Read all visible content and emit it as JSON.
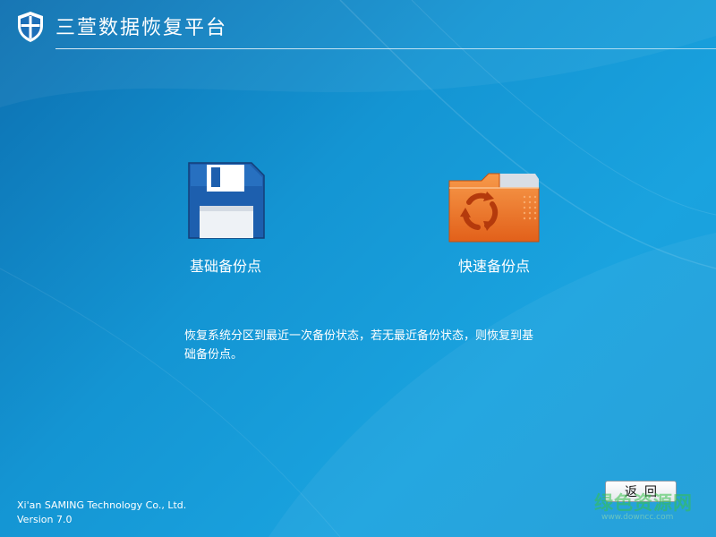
{
  "header": {
    "title": "三萱数据恢复平台"
  },
  "options": [
    {
      "label": "基础备份点",
      "icon": "floppy-disk-icon"
    },
    {
      "label": "快速备份点",
      "icon": "recycle-folder-icon"
    }
  ],
  "description": "恢复系统分区到最近一次备份状态，若无最近备份状态，则恢复到基础备份点。",
  "footer": {
    "company": "Xi'an SAMING Technology Co., Ltd.",
    "version": "Version  7.0"
  },
  "actions": {
    "back_label": "返回"
  },
  "watermark": {
    "text": "绿色资源网",
    "url": "www.downcc.com"
  },
  "colors": {
    "background": "#1495d3",
    "folder_orange": "#f07a2a",
    "floppy_blue": "#1e5fb0"
  }
}
